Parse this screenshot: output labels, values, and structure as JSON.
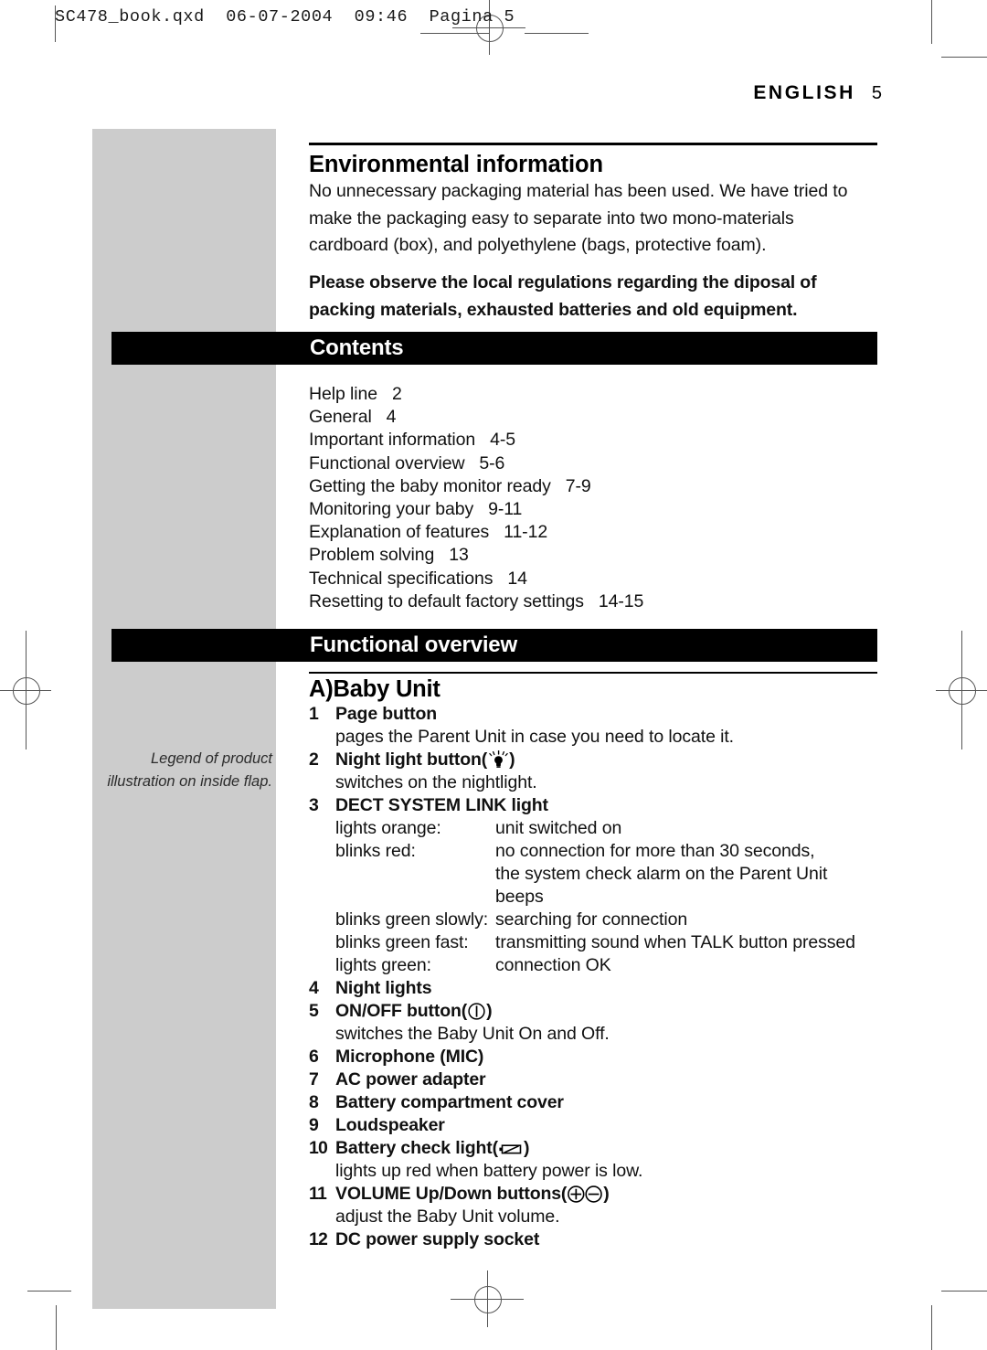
{
  "print_marks": {
    "filename_line": "SC478_book.qxd  06-07-2004  09:46  Pagina 5"
  },
  "page": {
    "language": "ENGLISH",
    "page_number": "5"
  },
  "sidebar": {
    "legend_line_1": "Legend of product",
    "legend_line_2": "illustration on inside flap."
  },
  "environmental": {
    "heading": "Environmental information",
    "paragraph": "No unnecessary packaging material has been used. We have tried to make the packaging easy to separate into two mono-materials cardboard (box), and polyethylene (bags, protective foam).",
    "notice": "Please observe the local regulations regarding the diposal of packing materials, exhausted batteries and old equipment."
  },
  "contents": {
    "bar_title": "Contents",
    "entries": [
      {
        "title": "Help line",
        "pages": "2"
      },
      {
        "title": "General",
        "pages": "4"
      },
      {
        "title": "Important information",
        "pages": "4-5"
      },
      {
        "title": "Functional overview",
        "pages": "5-6"
      },
      {
        "title": "Getting the baby monitor ready",
        "pages": "7-9"
      },
      {
        "title": "Monitoring your baby",
        "pages": "9-11"
      },
      {
        "title": "Explanation of features",
        "pages": "11-12"
      },
      {
        "title": "Problem solving",
        "pages": "13"
      },
      {
        "title": "Technical specifications",
        "pages": "14"
      },
      {
        "title": "Resetting to default factory settings",
        "pages": "14-15"
      }
    ]
  },
  "functional_overview": {
    "bar_title": "Functional overview",
    "subsection": "A)Baby Unit",
    "items": [
      {
        "num": "1",
        "label": "Page button",
        "icon": null,
        "desc": "pages the Parent Unit in case you need to locate it."
      },
      {
        "num": "2",
        "label": "Night light button",
        "icon": "lightbulb-icon",
        "desc": "switches on the nightlight."
      },
      {
        "num": "3",
        "label": "DECT SYSTEM LINK light",
        "icon": null,
        "desc": null,
        "states": [
          {
            "state": "lights orange:",
            "meaning": "unit switched on"
          },
          {
            "state": "blinks red:",
            "meaning": "no connection for more than 30 seconds,",
            "continuation": "the system check alarm on the Parent Unit beeps"
          },
          {
            "state": "blinks green slowly:",
            "meaning": "searching for connection"
          },
          {
            "state": "blinks green fast:",
            "meaning": "transmitting sound when TALK button pressed"
          },
          {
            "state": "lights green:",
            "meaning": "connection OK"
          }
        ]
      },
      {
        "num": "4",
        "label": "Night lights",
        "icon": null,
        "desc": null
      },
      {
        "num": "5",
        "label": "ON/OFF button",
        "icon": "power-icon",
        "desc": "switches the Baby Unit On and Off."
      },
      {
        "num": "6",
        "label": "Microphone (MIC)",
        "icon": null,
        "desc": null
      },
      {
        "num": "7",
        "label": "AC power adapter",
        "icon": null,
        "desc": null
      },
      {
        "num": "8",
        "label": "Battery compartment cover",
        "icon": null,
        "desc": null
      },
      {
        "num": "9",
        "label": "Loudspeaker",
        "icon": null,
        "desc": null
      },
      {
        "num": "10",
        "label": "Battery check light",
        "icon": "battery-icon",
        "desc": "lights up red when battery power is low."
      },
      {
        "num": "11",
        "label": "VOLUME Up/Down buttons",
        "icon": "plus-minus-icon",
        "desc": "adjust the Baby Unit volume."
      },
      {
        "num": "12",
        "label": "DC power supply socket",
        "icon": null,
        "desc": null
      }
    ]
  },
  "colors": {
    "sidebar_gray": "#cccccc",
    "bar_black": "#000000",
    "text": "#111111",
    "mark_gray": "#555555"
  }
}
